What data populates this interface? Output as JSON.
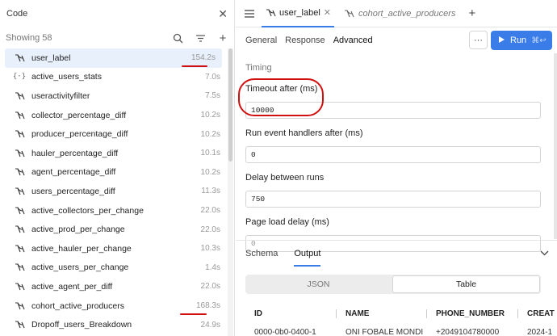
{
  "left_panel": {
    "title": "Code",
    "count_text": "Showing 58",
    "items": [
      {
        "name": "user_label",
        "time": "154.2s",
        "type": "query"
      },
      {
        "name": "active_users_stats",
        "time": "7.0s",
        "type": "function"
      },
      {
        "name": "useractivityfilter",
        "time": "7.5s",
        "type": "query"
      },
      {
        "name": "collector_percentage_diff",
        "time": "10.2s",
        "type": "query"
      },
      {
        "name": "producer_percentage_diff",
        "time": "10.2s",
        "type": "query"
      },
      {
        "name": "hauler_percentage_diff",
        "time": "10.1s",
        "type": "query"
      },
      {
        "name": "agent_percentage_diff",
        "time": "10.2s",
        "type": "query"
      },
      {
        "name": "users_percentage_diff",
        "time": "11.3s",
        "type": "query"
      },
      {
        "name": "active_collectors_per_change",
        "time": "22.0s",
        "type": "query"
      },
      {
        "name": "active_prod_per_change",
        "time": "22.0s",
        "type": "query"
      },
      {
        "name": "active_hauler_per_change",
        "time": "10.3s",
        "type": "query"
      },
      {
        "name": "active_users_per_change",
        "time": "1.4s",
        "type": "query"
      },
      {
        "name": "active_agent_per_diff",
        "time": "22.0s",
        "type": "query"
      },
      {
        "name": "cohort_active_producers",
        "time": "168.3s",
        "type": "query"
      },
      {
        "name": "Dropoff_users_Breakdown",
        "time": "24.9s",
        "type": "query"
      }
    ]
  },
  "tabs": [
    {
      "label": "user_label",
      "active": true
    },
    {
      "label": "cohort_active_producers",
      "active": false
    }
  ],
  "toolbar": {
    "tabs": [
      "General",
      "Response",
      "Advanced"
    ],
    "active_tab": "Advanced",
    "more_label": "···",
    "run_label": "Run",
    "run_shortcut": "⌘↩"
  },
  "advanced": {
    "section_title": "Timing",
    "fields": [
      {
        "label": "Timeout after (ms)",
        "value": "10000"
      },
      {
        "label": "Run event handlers after (ms)",
        "value": "0"
      },
      {
        "label": "Delay between runs",
        "value": "750"
      },
      {
        "label": "Page load delay (ms)",
        "value": "0"
      }
    ]
  },
  "results": {
    "tabs": [
      "Schema",
      "Output"
    ],
    "active_tab": "Output",
    "view_options": [
      "JSON",
      "Table"
    ],
    "active_view": "Table",
    "columns": [
      "ID",
      "NAME",
      "PHONE_NUMBER",
      "CREAT"
    ],
    "partial_row": [
      "0000-0b0-0400-1",
      "ONI FOBALE MONDI",
      "+2049104780000",
      "2024-1"
    ]
  },
  "colors": {
    "accent": "#3b7de8",
    "annotation": "#d01010"
  }
}
